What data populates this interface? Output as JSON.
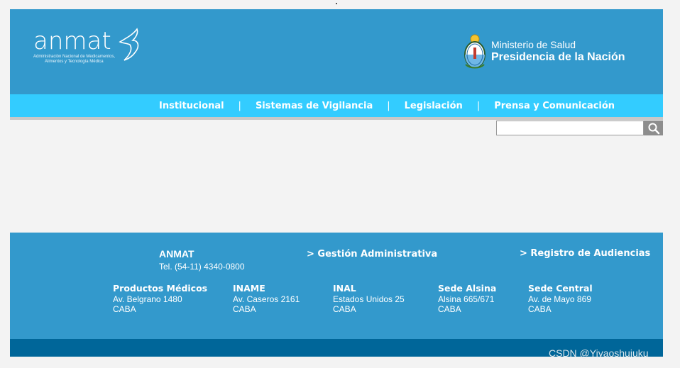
{
  "header": {
    "logo_word": "anmat",
    "logo_sub_line1": "Administración Nacional de Medicamentos,",
    "logo_sub_line2": "Alimentos y Tecnología Médica",
    "ministry_line1": "Ministerio de Salud",
    "ministry_line2": "Presidencia de la Nación"
  },
  "nav": {
    "items": [
      {
        "label": "Institucional"
      },
      {
        "label": "Sistemas de Vigilancia"
      },
      {
        "label": "Legislación"
      },
      {
        "label": "Prensa y Comunicación"
      }
    ],
    "separator": "|"
  },
  "search": {
    "placeholder": "",
    "value": "",
    "icon": "search-icon"
  },
  "footer": {
    "title": "ANMAT",
    "tel": "Tel. (54-11) 4340-0800",
    "links": [
      {
        "label": "> Gestión Administrativa"
      },
      {
        "label": "> Registro de Audiencias"
      }
    ],
    "offices": [
      {
        "name": "Productos Médicos",
        "address": "Av. Belgrano 1480",
        "city": "CABA"
      },
      {
        "name": "INAME",
        "address": "Av. Caseros 2161",
        "city": "CABA"
      },
      {
        "name": "INAL",
        "address": "Estados Unidos 25",
        "city": "CABA"
      },
      {
        "name": "Sede Alsina",
        "address": "Alsina 665/671",
        "city": "CABA"
      },
      {
        "name": "Sede Central",
        "address": "Av. de Mayo 869",
        "city": "CABA"
      }
    ]
  },
  "watermark": "CSDN @Yiyaoshujuku",
  "colors": {
    "header_bg": "#3399cc",
    "nav_bg": "#33ccff",
    "footer_bottom_bg": "#006699",
    "page_bg": "#f3f3f3"
  }
}
